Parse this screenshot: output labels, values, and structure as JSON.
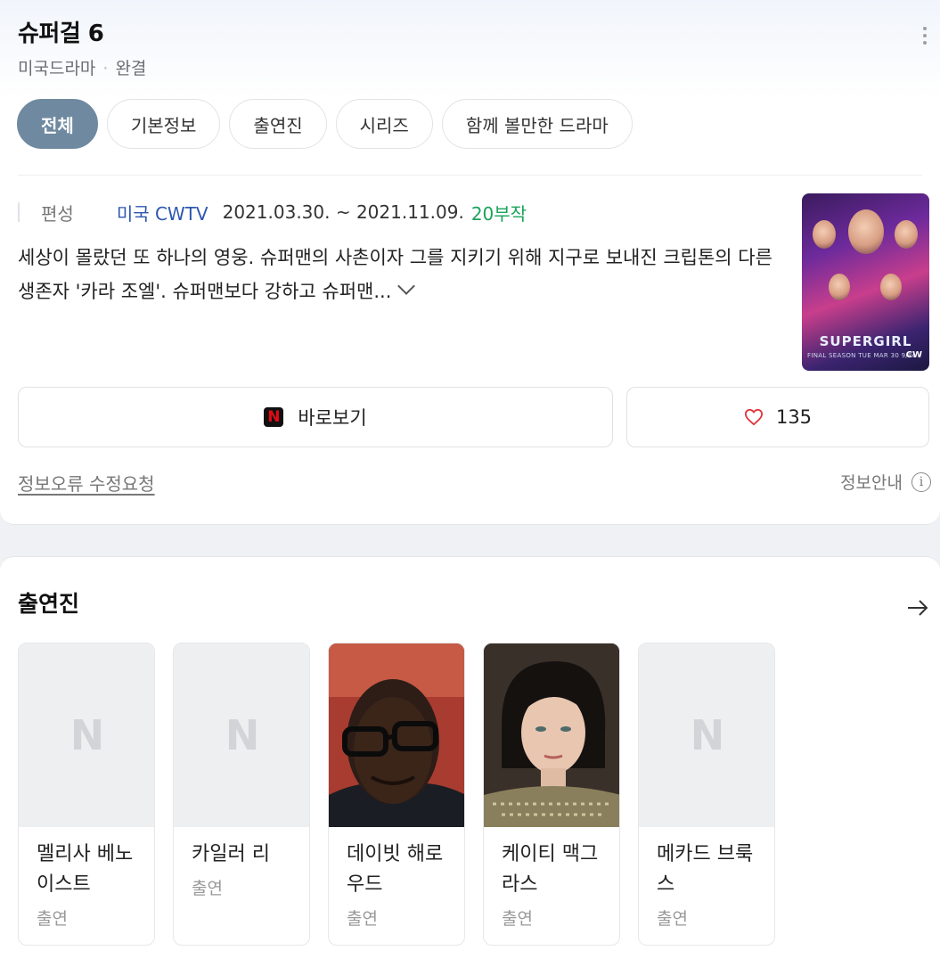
{
  "header": {
    "title": "슈퍼걸 6",
    "genre": "미국드라마",
    "status": "완결"
  },
  "tabs": [
    {
      "label": "전체",
      "active": true
    },
    {
      "label": "기본정보",
      "active": false
    },
    {
      "label": "출연진",
      "active": false
    },
    {
      "label": "시리즈",
      "active": false
    },
    {
      "label": "함께 볼만한 드라마",
      "active": false
    }
  ],
  "info": {
    "label": "편성",
    "network": "미국 CWTV",
    "dates": "2021.03.30. ~ 2021.11.09.",
    "episodes": "20부작"
  },
  "description": "세상이 몰랐던 또 하나의 영웅. 슈퍼맨의 사촌이자 그를 지키기 위해 지구로 보내진 크립톤의 다른 생존자 '카라 조엘'. 슈퍼맨보다 강하고 슈퍼맨...",
  "poster": {
    "logo_text": "SUPERGIRL",
    "tagline": "FINAL SEASON TUE MAR 30 9/8c",
    "network_badge": "CW"
  },
  "actions": {
    "watch_label": "바로보기",
    "watch_icon": "netflix-icon",
    "like_count": "135",
    "like_icon": "heart-icon"
  },
  "footer": {
    "fix_request": "정보오류 수정요청",
    "info_guide": "정보안내"
  },
  "cast_section": {
    "title": "출연진",
    "members": [
      {
        "name": "멜리사 베노이스트",
        "role": "출연",
        "photo": "placeholder"
      },
      {
        "name": "카일러 리",
        "role": "출연",
        "photo": "placeholder"
      },
      {
        "name": "데이빗 해로우드",
        "role": "출연",
        "photo": "portrait"
      },
      {
        "name": "케이티 맥그라스",
        "role": "출연",
        "photo": "portrait"
      },
      {
        "name": "메카드 브룩스",
        "role": "출연",
        "photo": "placeholder"
      }
    ]
  },
  "colors": {
    "active_tab": "#6f8aa0",
    "link": "#2d57b0",
    "episodes": "#1aa35a",
    "heart": "#e0343c"
  }
}
